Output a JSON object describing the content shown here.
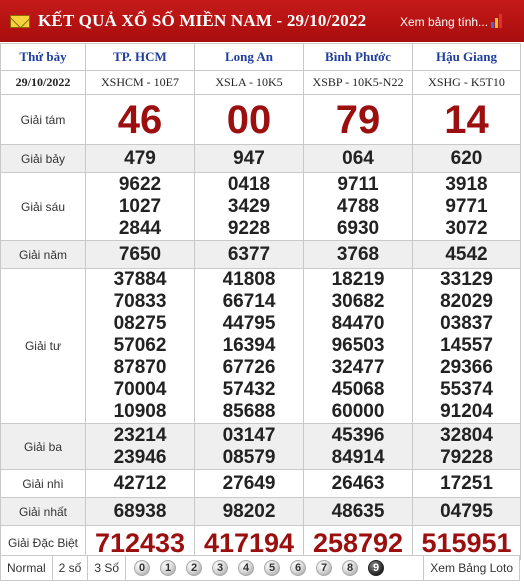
{
  "header": {
    "title": "KẾT QUẢ XỔ SỐ MIỀN NAM - 29/10/2022",
    "more_link": "Xem bảng tính..."
  },
  "table": {
    "day": "Thứ bảy",
    "date": "29/10/2022",
    "provinces": [
      "TP. HCM",
      "Long An",
      "Bình Phước",
      "Hậu Giang"
    ],
    "codes": [
      "XSHCM - 10E7",
      "XSLA - 10K5",
      "XSBP - 10K5-N22",
      "XSHG - K5T10"
    ],
    "prizes": [
      {
        "label": "Giải tám",
        "values": [
          [
            "46"
          ],
          [
            "00"
          ],
          [
            "79"
          ],
          [
            "14"
          ]
        ]
      },
      {
        "label": "Giải bảy",
        "values": [
          [
            "479"
          ],
          [
            "947"
          ],
          [
            "064"
          ],
          [
            "620"
          ]
        ]
      },
      {
        "label": "Giải sáu",
        "values": [
          [
            "9622",
            "1027",
            "2844"
          ],
          [
            "0418",
            "3429",
            "9228"
          ],
          [
            "9711",
            "4788",
            "6930"
          ],
          [
            "3918",
            "9771",
            "3072"
          ]
        ]
      },
      {
        "label": "Giải năm",
        "values": [
          [
            "7650"
          ],
          [
            "6377"
          ],
          [
            "3768"
          ],
          [
            "4542"
          ]
        ]
      },
      {
        "label": "Giải tư",
        "values": [
          [
            "37884",
            "70833",
            "08275",
            "57062",
            "87870",
            "70004",
            "10908"
          ],
          [
            "41808",
            "66714",
            "44795",
            "16394",
            "67726",
            "57432",
            "85688"
          ],
          [
            "18219",
            "30682",
            "84470",
            "96503",
            "32477",
            "45068",
            "60000"
          ],
          [
            "33129",
            "82029",
            "03837",
            "14557",
            "29366",
            "55374",
            "91204"
          ]
        ]
      },
      {
        "label": "Giải ba",
        "values": [
          [
            "23214",
            "23946"
          ],
          [
            "03147",
            "08579"
          ],
          [
            "45396",
            "84914"
          ],
          [
            "32804",
            "79228"
          ]
        ]
      },
      {
        "label": "Giải nhì",
        "values": [
          [
            "42712"
          ],
          [
            "27649"
          ],
          [
            "26463"
          ],
          [
            "17251"
          ]
        ]
      },
      {
        "label": "Giải nhất",
        "values": [
          [
            "68938"
          ],
          [
            "98202"
          ],
          [
            "48635"
          ],
          [
            "04795"
          ]
        ]
      },
      {
        "label": "Giải Đặc Biệt",
        "values": [
          [
            "712433"
          ],
          [
            "417194"
          ],
          [
            "258792"
          ],
          [
            "515951"
          ]
        ]
      }
    ]
  },
  "footer": {
    "options": [
      "Normal",
      "2 số",
      "3 Số"
    ],
    "digits": [
      "0",
      "1",
      "2",
      "3",
      "4",
      "5",
      "6",
      "7",
      "8",
      "9"
    ],
    "loto_link": "Xem Bảng Loto"
  },
  "colors": {
    "header_bg": "#b31414",
    "province_text": "#1f3f9e",
    "special_numbers": "#9b0f0f",
    "row_shade": "#efefef"
  }
}
